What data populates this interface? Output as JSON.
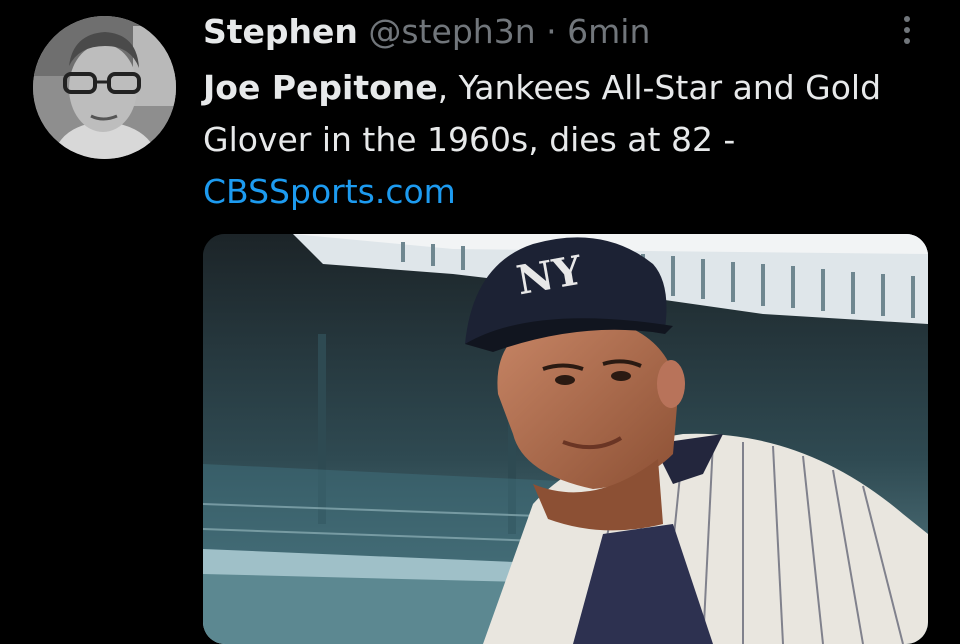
{
  "tweet": {
    "author_name": "Stephen",
    "handle": "@steph3n",
    "separator": "·",
    "time": "6min",
    "text_bold": "Joe Pepitone",
    "text_rest": ", Yankees All-Star and Gold Glover in the 1960s, dies at 82 - ",
    "link": "CBSSports.com"
  },
  "icons": {
    "more": "more-vertical-icon"
  },
  "colors": {
    "background": "#000000",
    "text": "#e7e9ea",
    "muted": "#71767b",
    "link": "#1d9bf0"
  }
}
